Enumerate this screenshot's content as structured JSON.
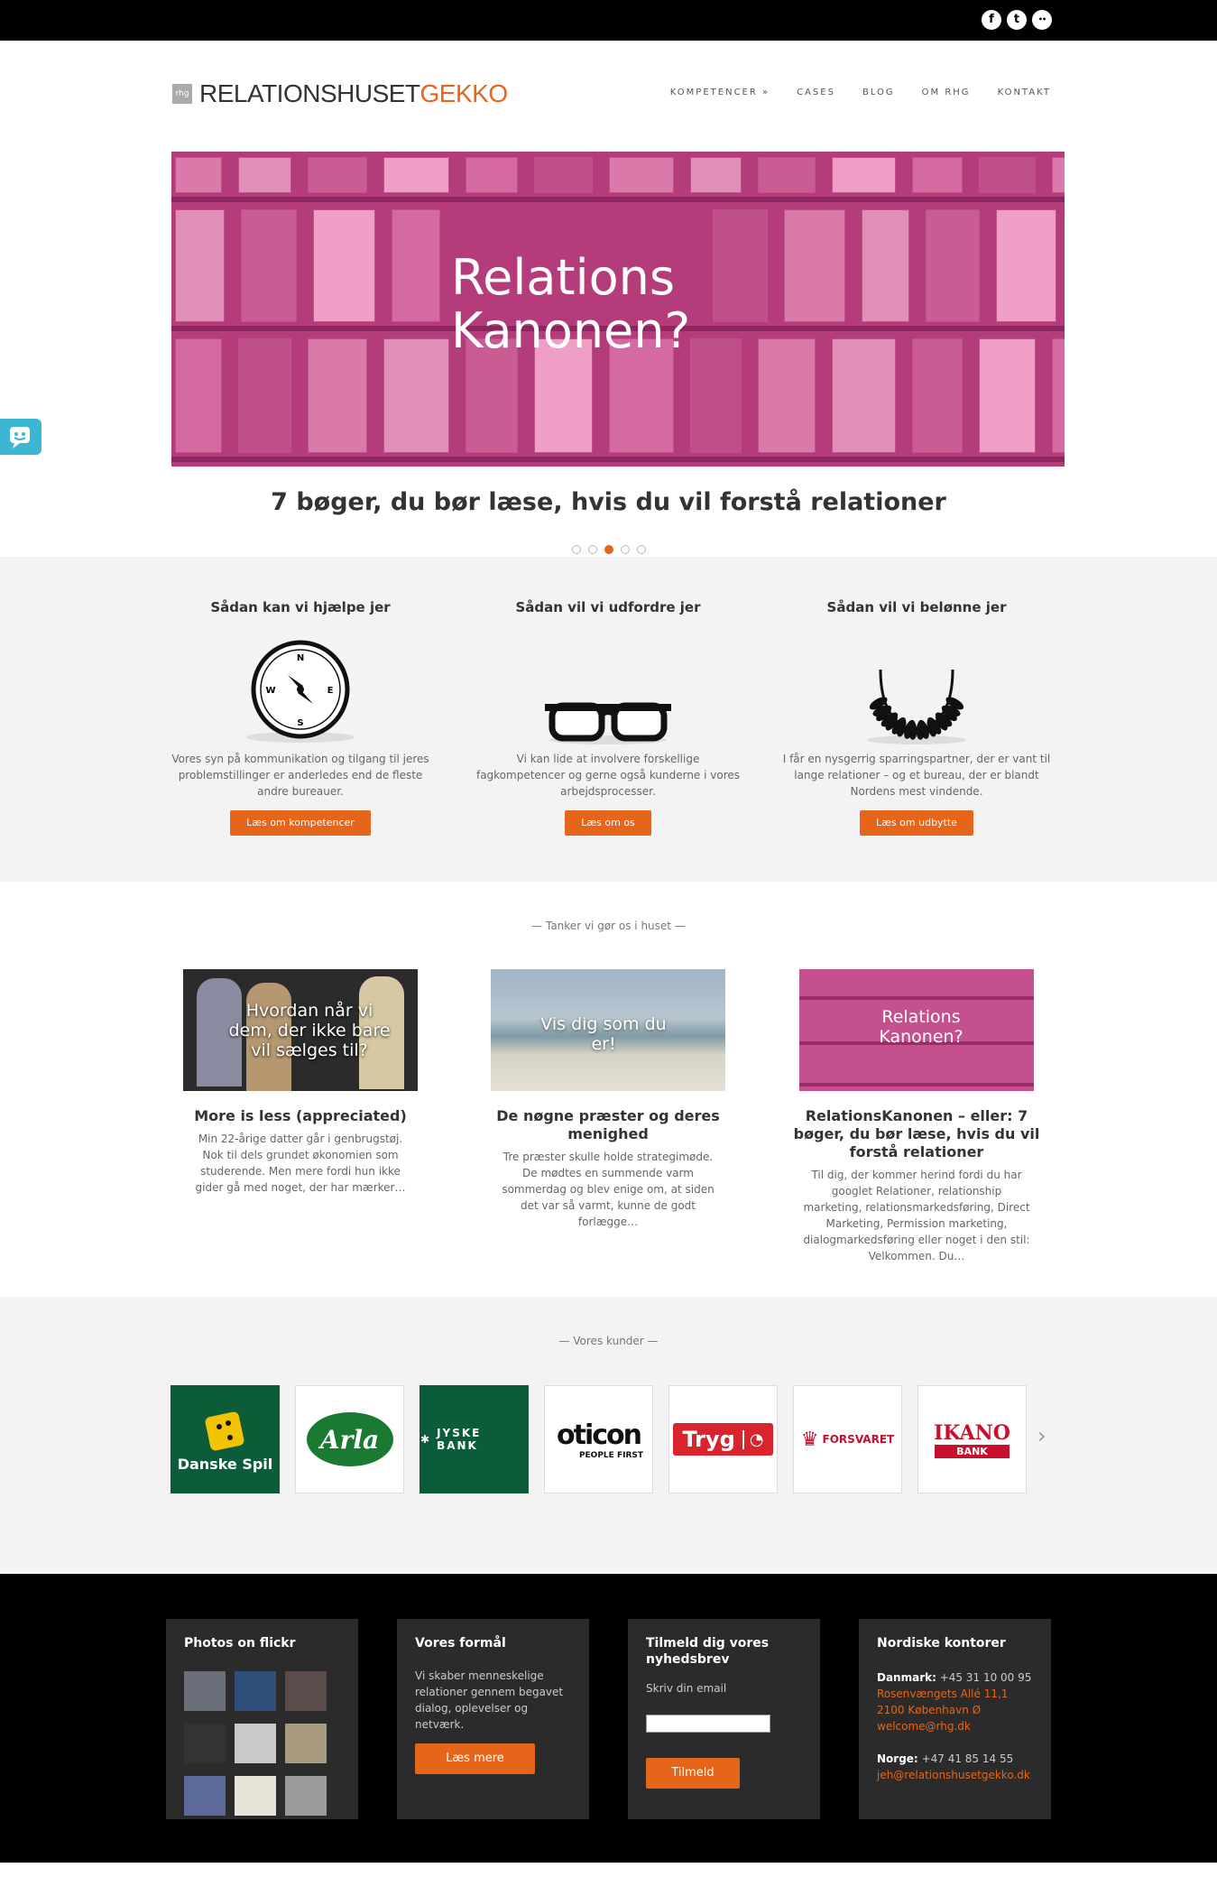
{
  "social": {
    "facebook": "f",
    "twitter": "t",
    "flickr": "••"
  },
  "logo": {
    "mark": "rhg",
    "part1": "RELATIONSHUSET",
    "part2": "GEKKO"
  },
  "nav": [
    "KOMPETENCER »",
    "CASES",
    "BLOG",
    "OM RHG",
    "KONTAKT"
  ],
  "hero": {
    "title1": "Relations",
    "title2": "Kanonen?",
    "caption": "7 bøger, du bør læse, hvis du vil forstå relationer",
    "active_dot": 3,
    "dot_count": 5
  },
  "services": [
    {
      "title": "Sådan kan vi hjælpe jer",
      "icon": "compass-icon",
      "compass": [
        "N",
        "E",
        "S",
        "W"
      ],
      "text": "Vores syn på kommunikation og tilgang til jeres problemstillinger er anderledes end de fleste andre bureauer.",
      "button": "Læs om kompetencer"
    },
    {
      "title": "Sådan vil vi udfordre jer",
      "icon": "glasses-icon",
      "text": "Vi kan lide at involvere forskellige fagkompetencer og gerne også kunderne i vores arbejdsprocesser.",
      "button": "Læs om os"
    },
    {
      "title": "Sådan vil vi belønne jer",
      "icon": "laurel-icon",
      "text": "I får en nysgerrig sparringspartner, der er vant til lange relationer – og et bureau, der er blandt Nordens mest vindende.",
      "button": "Læs om udbytte"
    }
  ],
  "thoughts_label": "— Tanker vi gør os i huset —",
  "posts": [
    {
      "thumb_text": "Hvordan når vi dem, der ikke bare vil sælges til?",
      "title": "More is less (appreciated)",
      "text": "Min 22-årige datter går i genbrugstøj. Nok til dels grundet økonomien som studerende. Men mere fordi hun ikke gider gå med noget, der har mærker…"
    },
    {
      "thumb_text": "Vis dig som du er!",
      "title": "De nøgne præster og deres menighed",
      "text": "Tre præster skulle holde strategimøde. De mødtes en summende varm sommerdag og blev enige om, at siden det var så varmt, kunne de godt forlægge…"
    },
    {
      "thumb_text": "Relations Kanonen?",
      "title": "RelationsKanonen – eller: 7 bøger, du bør læse, hvis du vil forstå relationer",
      "text": "Til dig, der kommer herind fordi du har googlet Relationer, relationship marketing, relationsmarkedsføring, Direct Marketing, Permission marketing, dialogmarkedsføring eller noget i den stil: Velkommen. Du…"
    }
  ],
  "clients_label": "— Vores kunder —",
  "clients": [
    "Danske Spil",
    "Arla",
    "JYSKE BANK",
    "oticon",
    "PEOPLE FIRST",
    "Tryg",
    "FORSVARET",
    "IKANO",
    "BANK"
  ],
  "carousel_next": "›",
  "footer": {
    "flickr_title": "Photos on flickr",
    "purpose_title": "Vores formål",
    "purpose_text": "Vi skaber menneskelige relationer gennem begavet dialog, oplevelser og netværk.",
    "purpose_button": "Læs mere",
    "newsletter_title": "Tilmeld dig vores nyhedsbrev",
    "newsletter_label": "Skriv din email",
    "newsletter_button": "Tilmeld",
    "offices_title": "Nordiske kontorer",
    "dk_label": "Danmark:",
    "dk_phone": "+45 31 10 00 95",
    "dk_address1": "Rosenvængets Allé 11,1",
    "dk_address2": "2100 København Ø",
    "dk_email": "welcome@rhg.dk",
    "no_label": "Norge:",
    "no_phone": "+47 41 85 14 55",
    "no_email": "jeh@relationshusetgekko.dk"
  },
  "colors": {
    "accent": "#e5651a",
    "hero": "#b43c7b",
    "chat": "#3bb6d3"
  }
}
